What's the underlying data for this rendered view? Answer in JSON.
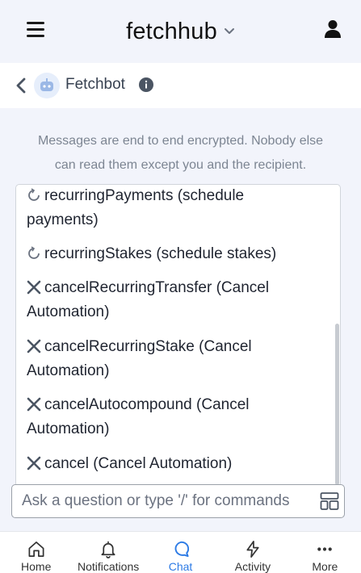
{
  "header": {
    "brand": "fetchhub"
  },
  "chat": {
    "bot_name": "Fetchbot",
    "encryption_line1": "Messages are end to end encrypted. Nobody else",
    "encryption_line2": "can read them except you and the recipient."
  },
  "commands": [
    {
      "icon": "refresh-icon",
      "line1": "recurringPayments (schedule",
      "line2": "payments)"
    },
    {
      "icon": "refresh-icon",
      "line1": "recurringStakes (schedule stakes)",
      "line2": ""
    },
    {
      "icon": "close-icon",
      "line1": "cancelRecurringTransfer (Cancel",
      "line2": "Automation)"
    },
    {
      "icon": "close-icon",
      "line1": "cancelRecurringStake (Cancel",
      "line2": "Automation)"
    },
    {
      "icon": "close-icon",
      "line1": "cancelAutocompound (Cancel",
      "line2": "Automation)"
    },
    {
      "icon": "close-icon",
      "line1": "cancel (Cancel Automation)",
      "line2": ""
    }
  ],
  "input": {
    "placeholder": "Ask a question or type '/' for commands",
    "value": ""
  },
  "nav": {
    "items": [
      {
        "label": "Home",
        "icon": "home-icon",
        "active": false
      },
      {
        "label": "Notifications",
        "icon": "bell-icon",
        "active": false
      },
      {
        "label": "Chat",
        "icon": "chat-icon",
        "active": true
      },
      {
        "label": "Activity",
        "icon": "lightning-icon",
        "active": false
      },
      {
        "label": "More",
        "icon": "more-icon",
        "active": false
      }
    ]
  },
  "colors": {
    "accent": "#2d7be5",
    "background": "#f2f4fb"
  }
}
